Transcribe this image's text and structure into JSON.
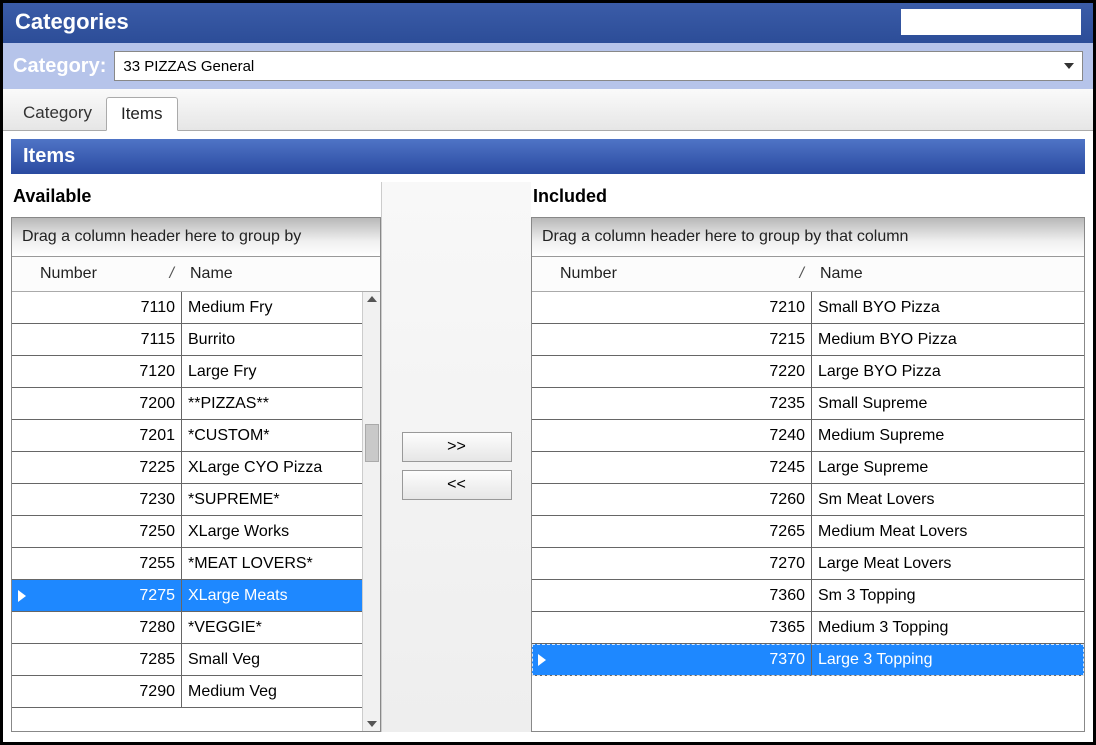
{
  "title": "Categories",
  "category_selector": {
    "label": "Category:",
    "value": "33 PIZZAS General"
  },
  "tabs": [
    {
      "label": "Category",
      "active": false
    },
    {
      "label": "Items",
      "active": true
    }
  ],
  "section_title": "Items",
  "panes": {
    "available": {
      "title": "Available",
      "group_hint": "Drag a column header here to group by",
      "columns": {
        "number": "Number",
        "name": "Name"
      },
      "selected_number": 7275,
      "rows": [
        {
          "number": 7110,
          "name": "Medium Fry"
        },
        {
          "number": 7115,
          "name": "Burrito"
        },
        {
          "number": 7120,
          "name": "Large Fry"
        },
        {
          "number": 7200,
          "name": "**PIZZAS**"
        },
        {
          "number": 7201,
          "name": "*CUSTOM*"
        },
        {
          "number": 7225,
          "name": "XLarge CYO Pizza"
        },
        {
          "number": 7230,
          "name": "*SUPREME*"
        },
        {
          "number": 7250,
          "name": "XLarge Works"
        },
        {
          "number": 7255,
          "name": "*MEAT LOVERS*"
        },
        {
          "number": 7275,
          "name": "XLarge Meats"
        },
        {
          "number": 7280,
          "name": "*VEGGIE*"
        },
        {
          "number": 7285,
          "name": "Small Veg"
        },
        {
          "number": 7290,
          "name": "Medium Veg"
        }
      ]
    },
    "included": {
      "title": "Included",
      "group_hint": "Drag a column header here to group by that column",
      "columns": {
        "number": "Number",
        "name": "Name"
      },
      "selected_number": 7370,
      "rows": [
        {
          "number": 7210,
          "name": "Small BYO Pizza"
        },
        {
          "number": 7215,
          "name": "Medium BYO Pizza"
        },
        {
          "number": 7220,
          "name": "Large BYO Pizza"
        },
        {
          "number": 7235,
          "name": "Small Supreme"
        },
        {
          "number": 7240,
          "name": "Medium Supreme"
        },
        {
          "number": 7245,
          "name": "Large Supreme"
        },
        {
          "number": 7260,
          "name": "Sm Meat Lovers"
        },
        {
          "number": 7265,
          "name": "Medium Meat Lovers"
        },
        {
          "number": 7270,
          "name": "Large Meat Lovers"
        },
        {
          "number": 7360,
          "name": "Sm 3 Topping"
        },
        {
          "number": 7365,
          "name": "Medium 3 Topping"
        },
        {
          "number": 7370,
          "name": "Large 3 Topping"
        }
      ]
    }
  },
  "buttons": {
    "add": ">>",
    "remove": "<<"
  }
}
